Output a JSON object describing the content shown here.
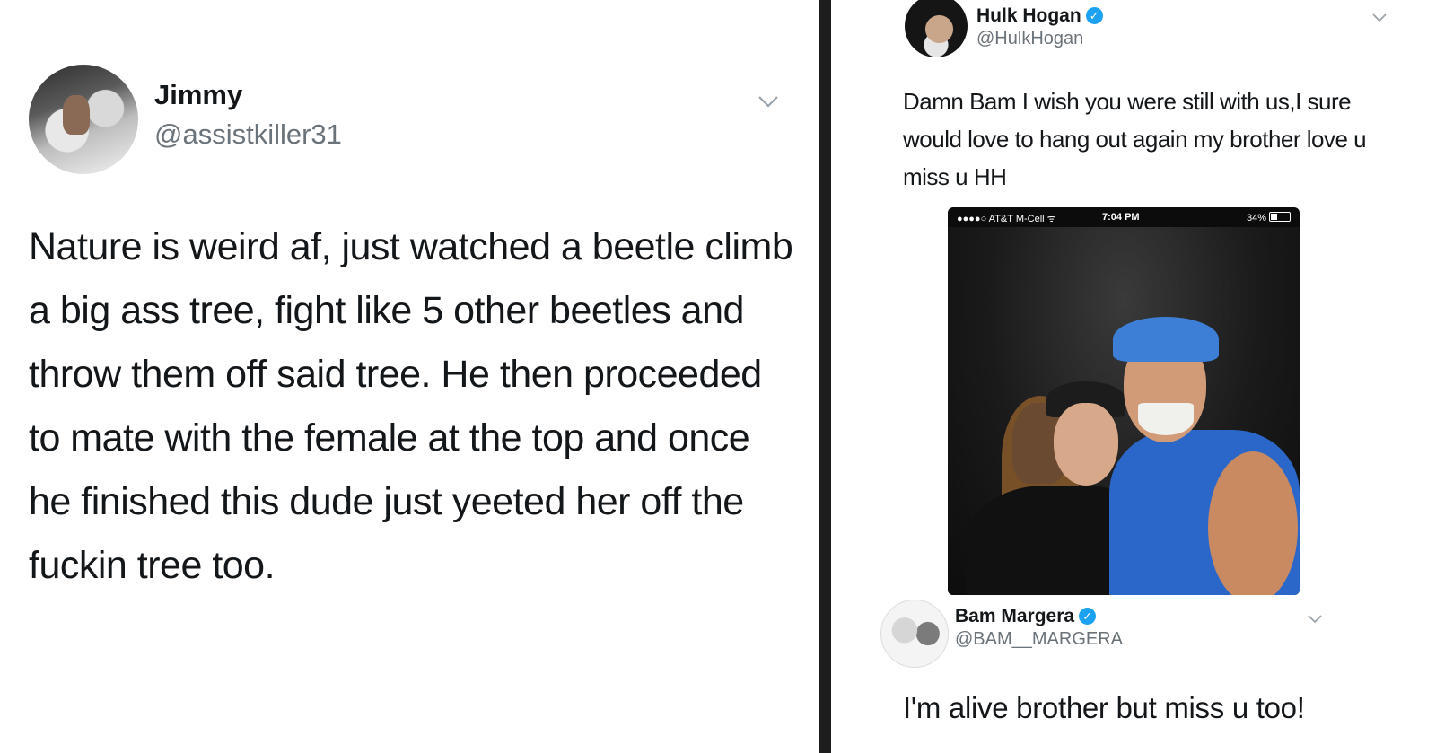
{
  "left_tweet": {
    "display_name": "Jimmy",
    "handle": "@assistkiller31",
    "text": "Nature is weird af, just watched a beetle climb a big ass tree, fight like 5 other beetles and throw them off said tree. He then proceeded to mate with the female at the top and once he finished this dude just yeeted her off the fuckin tree too.",
    "menu_icon": "chevron-down-icon"
  },
  "right_tweet": {
    "display_name": "Hulk Hogan",
    "handle": "@HulkHogan",
    "verified_icon": "verified-badge-icon",
    "text": "Damn  Bam I wish you were still with us,I sure would love to hang out again my brother love u miss u HH",
    "embedded_screenshot": {
      "carrier": "●●●●○ AT&T M-Cell ᯤ",
      "time": "7:04 PM",
      "battery": "34%"
    }
  },
  "reply_tweet": {
    "display_name": "Bam Margera",
    "handle": "@BAM__MARGERA",
    "verified_icon": "verified-badge-icon",
    "text": "I'm alive brother but miss u too!"
  },
  "colors": {
    "text": "#14171a",
    "secondary_text": "#6b737a",
    "verified_blue": "#1da1f2",
    "divider": "#1d1d1d"
  }
}
